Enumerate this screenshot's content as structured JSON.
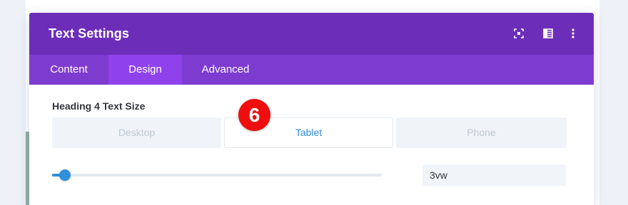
{
  "modal": {
    "title": "Text Settings",
    "header_icons": [
      "expand-icon",
      "sidebar-toggle-icon",
      "more-options-icon"
    ]
  },
  "tabs": [
    {
      "label": "Content",
      "active": false
    },
    {
      "label": "Design",
      "active": true
    },
    {
      "label": "Advanced",
      "active": false
    }
  ],
  "setting": {
    "label": "Heading 4 Text Size",
    "devices": [
      {
        "label": "Desktop",
        "active": false
      },
      {
        "label": "Tablet",
        "active": true
      },
      {
        "label": "Phone",
        "active": false
      }
    ],
    "slider_fraction": 0.04,
    "value": "3vw"
  },
  "step_badge": "6",
  "colors": {
    "header": "#6c2eb9",
    "tab_bar": "#7e3bd0",
    "active_tab": "#8f42ec",
    "accent": "#2e8fdb",
    "badge": "#f00d0d"
  }
}
